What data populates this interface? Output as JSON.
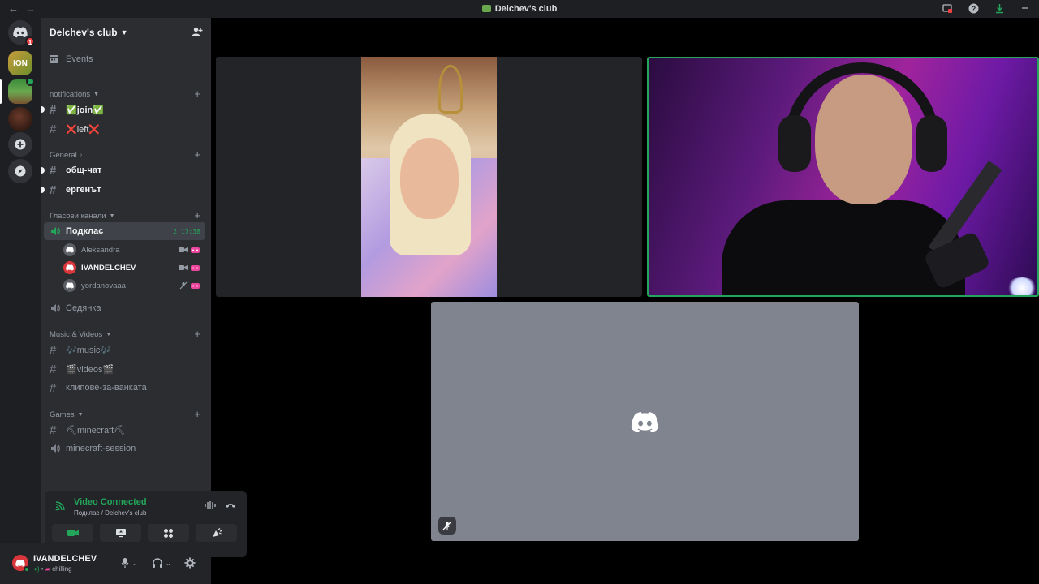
{
  "window": {
    "title": "Delchev's club"
  },
  "server": {
    "name": "Delchev's club",
    "events_label": "Events",
    "home_badge": "1"
  },
  "categories": {
    "notifications": "notifications",
    "general": "General",
    "voice": "Гласови канали",
    "music": "Music & Videos",
    "games": "Games"
  },
  "channels": {
    "join": "✅join✅",
    "left": "❌left❌",
    "chat": "общ-чат",
    "ergenat": "ергенът",
    "podklas": "Подклас",
    "podklas_timer": "2:17:38",
    "sedyanka": "Седянка",
    "music": "🎶music🎶",
    "videos": "🎬videos🎬",
    "clips": "клипове-за-ванката",
    "minecraft": "⛏minecraft⛏",
    "minecraft_session": "minecraft-session"
  },
  "voice_users": [
    {
      "name": "Aleksandra"
    },
    {
      "name": "IVANDELCHEV"
    },
    {
      "name": "yordanovaaa"
    }
  ],
  "voice_panel": {
    "status": "Video Connected",
    "location": "Подклас / Delchev's club"
  },
  "user": {
    "name": "IVANDELCHEV",
    "status": "chilling"
  },
  "colors": {
    "online": "#23a55a",
    "live_red": "#da373c",
    "blurple": "#5865f2"
  }
}
